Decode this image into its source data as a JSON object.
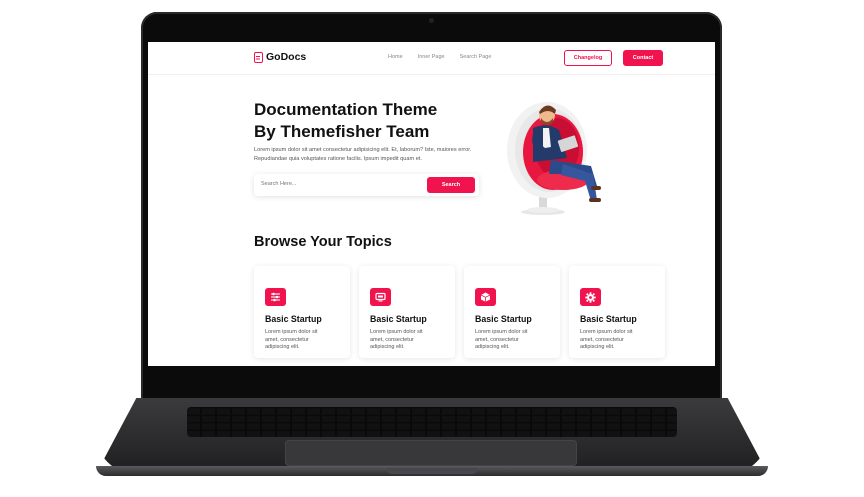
{
  "brand": {
    "name": "GoDocs",
    "accent": "#f0134d"
  },
  "nav": {
    "links": [
      "Home",
      "Inner Page",
      "Search Page"
    ],
    "changelog_label": "Changelog",
    "contact_label": "Contact"
  },
  "hero": {
    "title_line1": "Documentation Theme",
    "title_line2": "By Themefisher Team",
    "description": "Lorem ipsum dolor sit amet consectetur adipisicing elit. Et, laborum? Iste, maiores error. Repudiandae quia voluptates ratione facilis. Ipsum impedit quam et.",
    "search_placeholder": "Search Here...",
    "search_button": "Search"
  },
  "topics": {
    "heading": "Browse Your Topics",
    "cards": [
      {
        "icon": "sliders-icon",
        "title": "Basic Startup",
        "text": "Lorem ipsum dolor sit amet, consectetur adipiscing elit."
      },
      {
        "icon": "monitor-icon",
        "title": "Basic Startup",
        "text": "Lorem ipsum dolor sit amet, consectetur adipiscing elit."
      },
      {
        "icon": "cube-icon",
        "title": "Basic Startup",
        "text": "Lorem ipsum dolor sit amet, consectetur adipiscing elit."
      },
      {
        "icon": "gear-icon",
        "title": "Basic Startup",
        "text": "Lorem ipsum dolor sit amet, consectetur adipiscing elit."
      }
    ]
  }
}
